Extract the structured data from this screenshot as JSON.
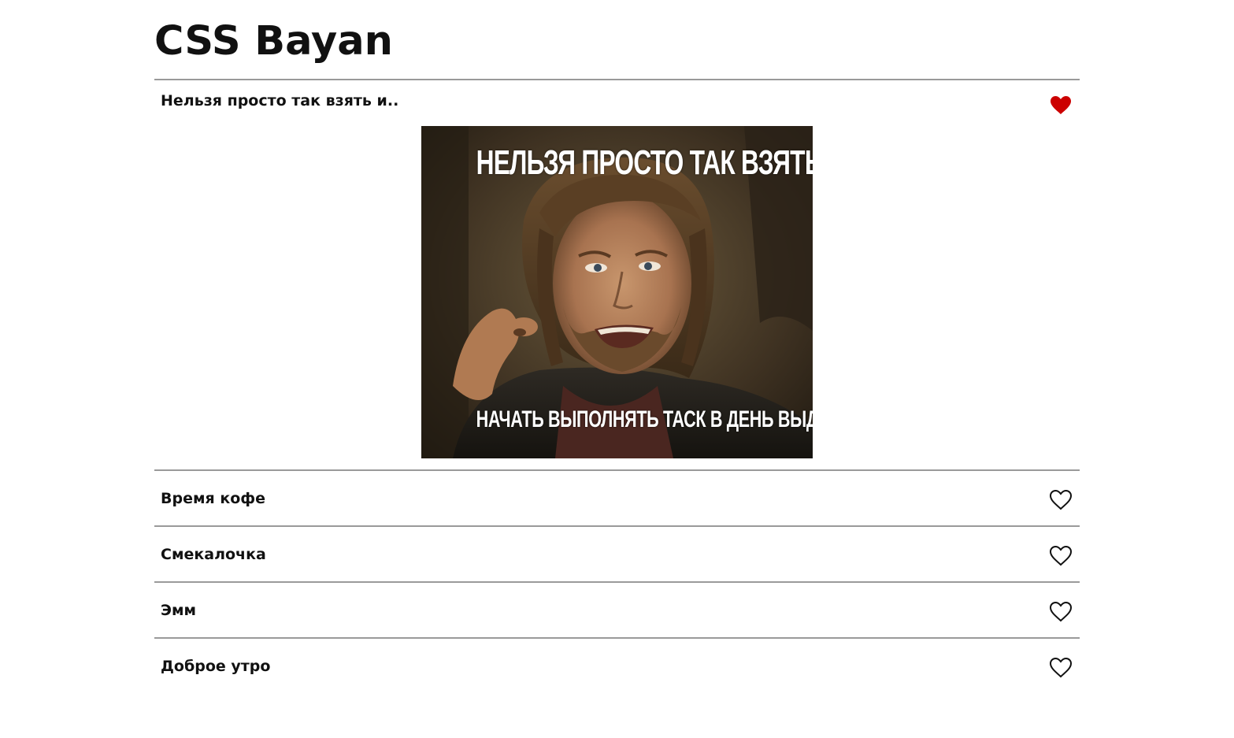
{
  "page": {
    "title": "CSS Bayan"
  },
  "colors": {
    "heart_active": "#cc0000",
    "heart_inactive": "#111111",
    "divider": "#9a9a9a"
  },
  "items": [
    {
      "title": "Нельзя просто так взять и..",
      "liked": true,
      "expanded": true,
      "meme": {
        "top_text": "Нельзя просто так взять и..",
        "bottom_text": "Начать выполнять таск в день выдачи"
      }
    },
    {
      "title": "Время кофе",
      "liked": false,
      "expanded": false
    },
    {
      "title": "Смекалочка",
      "liked": false,
      "expanded": false
    },
    {
      "title": "Эмм",
      "liked": false,
      "expanded": false
    },
    {
      "title": "Доброе утро",
      "liked": false,
      "expanded": false
    }
  ]
}
